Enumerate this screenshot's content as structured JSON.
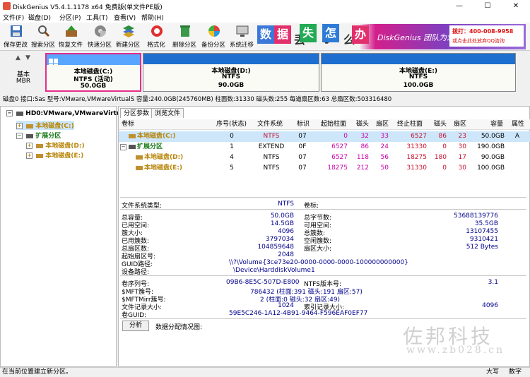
{
  "window": {
    "title": "DiskGenius V5.4.1.1178 x64 免费版(单文件PE版)",
    "min_glyph": "—",
    "max_glyph": "☐",
    "close_glyph": "✕"
  },
  "menu": [
    "文件(F)",
    "磁盘(D)",
    "分区(P)",
    "工具(T)",
    "查看(V)",
    "帮助(H)"
  ],
  "toolbar": [
    {
      "label": "保存更改",
      "icon": "save-icon"
    },
    {
      "label": "搜索分区",
      "icon": "search-partition-icon"
    },
    {
      "label": "恢复文件",
      "icon": "recover-files-icon"
    },
    {
      "label": "快速分区",
      "icon": "quick-partition-icon"
    },
    {
      "label": "新建分区",
      "icon": "new-partition-icon"
    },
    {
      "label": "格式化",
      "icon": "format-icon"
    },
    {
      "label": "删除分区",
      "icon": "delete-partition-icon"
    },
    {
      "label": "备份分区",
      "icon": "backup-partition-icon"
    },
    {
      "label": "系统迁移",
      "icon": "system-migration-icon"
    }
  ],
  "banner": {
    "chars": [
      "数",
      "据",
      "丢",
      "失",
      "了",
      "怎",
      "么",
      "办"
    ],
    "slogan": "DiskGenius 团队为您服务",
    "phone": "拨打：400-008-9958",
    "qq": "或点击此处放弃QQ咨询"
  },
  "disk_nav": {
    "type": "基本",
    "scheme": "MBR",
    "up": "▲",
    "down": "▼"
  },
  "partitions_bar": [
    {
      "name": "本地磁盘(C:)",
      "fs": "NTFS (活动)",
      "size": "50.0GB"
    },
    {
      "name": "本地磁盘(D:)",
      "fs": "NTFS",
      "size": "90.0GB"
    },
    {
      "name": "本地磁盘(E:)",
      "fs": "NTFS",
      "size": "100.0GB"
    }
  ],
  "disk_info": "磁盘0 接口:Sas  型号:VMware,VMwareVirtualS  容量:240.0GB(245760MB)  柱面数:31330  磁头数:255  每道扇区数:63  总扇区数:503316480",
  "tree": {
    "disk": "HD0:VMware,VMwareVirtual",
    "c": "本地磁盘(C:)",
    "ext": "扩展分区",
    "d": "本地磁盘(D:)",
    "e": "本地磁盘(E:)",
    "expand_glyph": "+",
    "collapse_glyph": "−"
  },
  "tabs": [
    "分区参数",
    "浏览文件"
  ],
  "table": {
    "headers": [
      "卷标",
      "序号(状态)",
      "文件系统",
      "标识",
      "起始柱面",
      "磁头",
      "扇区",
      "终止柱面",
      "磁头",
      "扇区",
      "容量",
      "属性"
    ],
    "rows": [
      {
        "label": "本地磁盘(C:)",
        "seq": "0",
        "fs": "NTFS",
        "id": "07",
        "sc": "0",
        "sh": "32",
        "ss": "33",
        "ec": "6527",
        "eh": "86",
        "es": "23",
        "cap": "50.0GB",
        "attr": "A"
      },
      {
        "label": "扩展分区",
        "seq": "1",
        "fs": "EXTEND",
        "id": "0F",
        "sc": "6527",
        "sh": "86",
        "ss": "24",
        "ec": "31330",
        "eh": "0",
        "es": "30",
        "cap": "190.0GB",
        "attr": ""
      },
      {
        "label": "本地磁盘(D:)",
        "seq": "4",
        "fs": "NTFS",
        "id": "07",
        "sc": "6527",
        "sh": "118",
        "ss": "56",
        "ec": "18275",
        "eh": "180",
        "es": "17",
        "cap": "90.0GB",
        "attr": ""
      },
      {
        "label": "本地磁盘(E:)",
        "seq": "5",
        "fs": "NTFS",
        "id": "07",
        "sc": "18275",
        "sh": "212",
        "ss": "50",
        "ec": "31330",
        "eh": "0",
        "es": "30",
        "cap": "100.0GB",
        "attr": ""
      }
    ]
  },
  "details": {
    "fs_type_label": "文件系统类型:",
    "fs_type": "NTFS",
    "volume_label": "卷标:",
    "total_label": "总容量:",
    "total": "50.0GB",
    "total_bytes_label": "总字节数:",
    "total_bytes": "53688139776",
    "used_label": "已用空间:",
    "used": "14.5GB",
    "free_label": "可用空间:",
    "free": "35.5GB",
    "cluster_label": "簇大小:",
    "cluster": "4096",
    "total_clusters_label": "总簇数:",
    "total_clusters": "13107455",
    "used_clusters_label": "已用簇数:",
    "used_clusters": "3797034",
    "free_clusters_label": "空闲簇数:",
    "free_clusters": "9310421",
    "total_sectors_label": "总扇区数:",
    "total_sectors": "104859648",
    "sector_size_label": "扇区大小:",
    "sector_size": "512 Bytes",
    "start_sector_label": "起始扇区号:",
    "start_sector": "2048",
    "guid_path_label": "GUID路径:",
    "guid_path": "\\\\?\\Volume{3ce73e20-0000-0000-0000-100000000000}",
    "device_path_label": "设备路径:",
    "device_path": "\\Device\\HarddiskVolume1",
    "serial_label": "卷序列号:",
    "serial": "09B6-8E5C-507D-E800",
    "ntfs_ver_label": "NTFS版本号:",
    "ntfs_ver": "3.1",
    "mft_label": "$MFT簇号:",
    "mft": "786432 (柱面:391 磁头:191 扇区:57)",
    "mftmirr_label": "$MFTMirr簇号:",
    "mftmirr": "2 (柱面:0 磁头:32 扇区:49)",
    "file_rec_label": "文件记录大小:",
    "file_rec": "1024",
    "index_rec_label": "索引记录大小:",
    "index_rec": "4096",
    "vol_guid_label": "卷GUID:",
    "vol_guid": "59E5C246-1A12-4B91-9464-F596EAF0EF77",
    "analyze_button": "分析",
    "analyze_label": "数据分配情况图:"
  },
  "watermark": {
    "text": "佐邦科技",
    "url": "www.zb028.cn"
  },
  "status": {
    "text": "在当前位置建立新分区。",
    "caps": "大写",
    "num": "数字"
  }
}
